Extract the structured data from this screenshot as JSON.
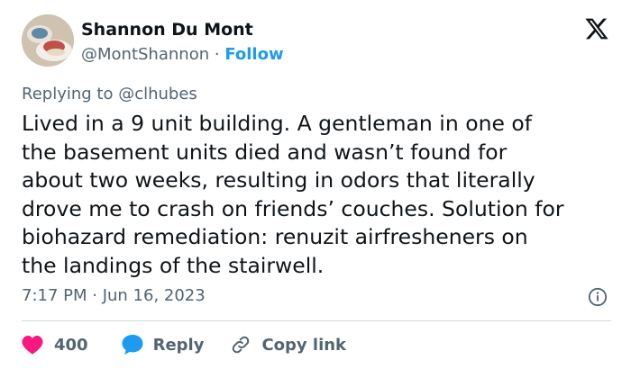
{
  "author": {
    "display_name": "Shannon Du Mont",
    "handle": "@MontShannon",
    "separator": "·",
    "follow_label": "Follow"
  },
  "logo_icon": "x-logo-icon",
  "replying": {
    "prefix": "Replying to",
    "mention": "@clhubes"
  },
  "tweet": {
    "text": "Lived in a 9 unit building. A gentleman in one of\nthe basement units died and wasn’t found for\nabout two weeks, resulting in odors that literally\ndrove me to crash on friends’ couches. Solution for\nbiohazard remediation: renuzit airfresheners on\nthe landings of the stairwell.",
    "timestamp": "7:17 PM · Jun 16, 2023"
  },
  "actions": {
    "like_count": "400",
    "reply_label": "Reply",
    "copy_link_label": "Copy link"
  },
  "colors": {
    "accent": "#1d9bf0",
    "like": "#f91880",
    "secondary_text": "#536471"
  }
}
